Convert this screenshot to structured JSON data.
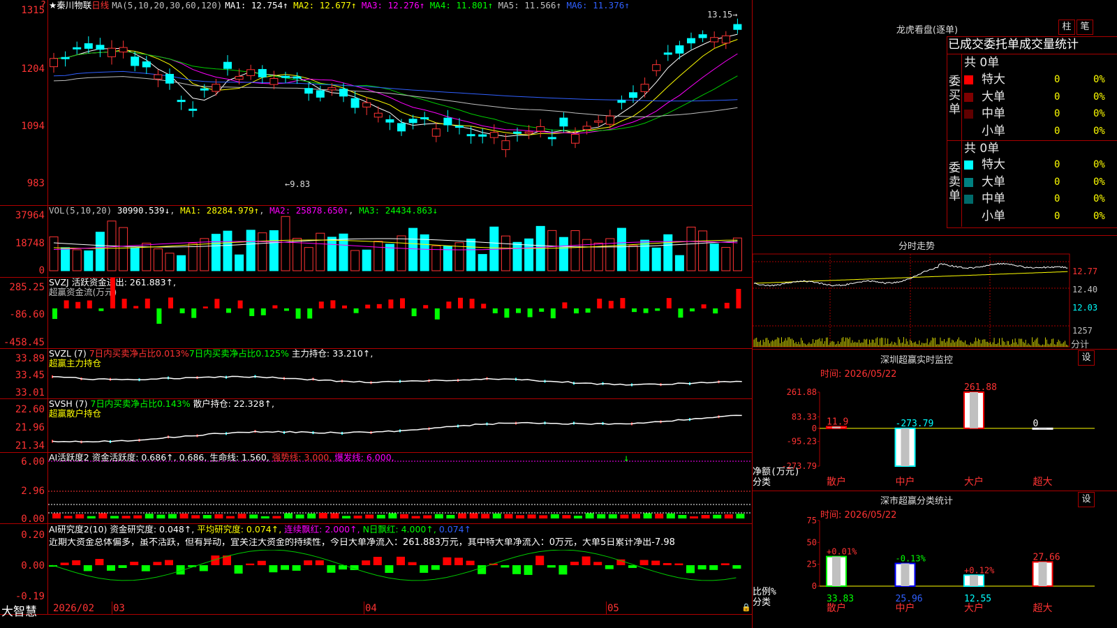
{
  "stock": {
    "name": "★秦川物联",
    "period": "日线",
    "ma_label": "MA(5,10,20,30,60,120)",
    "ma_values": [
      {
        "label": "MA1: 12.754↑",
        "color": "#ffffff"
      },
      {
        "label": "MA2: 12.677↑",
        "color": "#ffff00"
      },
      {
        "label": "MA3: 12.276↑",
        "color": "#ff00ff"
      },
      {
        "label": "MA4: 11.801↑",
        "color": "#00ff00"
      },
      {
        "label": "MA5: 11.566↑",
        "color": "#c0c0c0"
      },
      {
        "label": "MA6: 11.376↑",
        "color": "#3060ff"
      }
    ],
    "y_ticks": [
      "1315",
      "1204",
      "1094",
      "983"
    ],
    "high_mark": "13.15",
    "low_mark": "9.83"
  },
  "vol": {
    "label": "VOL(5,10,20)",
    "value": "30990.539↓",
    "ma1": "MA1: 28284.979↑",
    "ma2": "MA2: 25878.650↑",
    "ma3": "MA3: 24434.863↓",
    "y_ticks": [
      "37964",
      "18748",
      "0"
    ]
  },
  "svzj": {
    "label": "SVZJ  活跃资金进出: 261.883↑,",
    "subtitle": "超赢资金流(万元)",
    "y_ticks": [
      "285.25",
      "-86.60",
      "-458.45"
    ]
  },
  "svzl": {
    "label": "SVZL (7)",
    "t1": "7日内买卖净占比0.013%",
    "t2": "7日内买卖净占比0.125%",
    "t3": "主力持仓: 33.210↑,",
    "subtitle": "超赢主力持仓",
    "y_ticks": [
      "33.89",
      "33.45",
      "33.01"
    ]
  },
  "svsh": {
    "label": "SVSH (7)",
    "t1": "7日内买卖净占比0.143%",
    "t2": "散户持仓: 22.328↑,",
    "subtitle": "超赢散户持仓",
    "y_ticks": [
      "22.60",
      "21.96",
      "21.34"
    ]
  },
  "ai1": {
    "label": "AI活跃度2",
    "t1": "资金活跃度: 0.686↑, 0.686,",
    "t2": "生命线: 1.560,",
    "t3": "强势线: 3.000,",
    "t4": "爆发线: 6.000,",
    "y_ticks": [
      "6.00",
      "2.96",
      "0.00"
    ]
  },
  "ai2": {
    "label": "AI研究度2(10)",
    "t1": "资金研究度: 0.048↑,",
    "t2": "平均研究度: 0.074↑,",
    "t3": "连续飘红: 2.000↑,",
    "t4": "N日飘红: 4.000↑,",
    "t5": "0.074↑",
    "comment": "近期大资金总体偏多，虽不活跃，但有异动，宜关注大资金的持续性，今日大单净流入：261.883万元，其中特大单净流入：0万元，大单5日累计净出-7.98",
    "y_ticks": [
      "0.20",
      "0.00",
      "-0.19"
    ]
  },
  "footer": {
    "brand": "大智慧",
    "dates": [
      "2026/02",
      "03",
      "04",
      "05"
    ]
  },
  "longhu": {
    "title": "龙虎看盘(逐单)",
    "btn1": "柱",
    "btn2": "笔",
    "tabs": "已成交委托单成交量统计",
    "buy_label": "委买单",
    "sell_label": "委卖单",
    "buy_total": "共 0单",
    "sell_total": "共 0单",
    "buy_rows": [
      {
        "name": "特大",
        "count": "0",
        "pct": "0%",
        "color": "#ff0000"
      },
      {
        "name": "大单",
        "count": "0",
        "pct": "0%",
        "color": "#800000"
      },
      {
        "name": "中单",
        "count": "0",
        "pct": "0%",
        "color": "#600000"
      },
      {
        "name": "小单",
        "count": "0",
        "pct": "0%",
        "color": ""
      }
    ],
    "sell_rows": [
      {
        "name": "特大",
        "count": "0",
        "pct": "0%",
        "color": "#00ffff"
      },
      {
        "name": "大单",
        "count": "0",
        "pct": "0%",
        "color": "#008080"
      },
      {
        "name": "中单",
        "count": "0",
        "pct": "0%",
        "color": "#006a6a"
      },
      {
        "name": "小单",
        "count": "0",
        "pct": "0%",
        "color": ""
      }
    ]
  },
  "fenshi": {
    "title": "分时走势",
    "y_ticks": [
      "12.77",
      "12.40",
      "12.03"
    ],
    "vol_tick": "1257",
    "vol_label": "分计"
  },
  "monitor": {
    "title": "深圳超赢实时监控",
    "btn": "设",
    "time": "时间: 2026/05/22",
    "y_ticks": [
      "261.88",
      "83.33",
      "0",
      "-95.23",
      "-273.79"
    ],
    "unit": "净额(万元)",
    "cat_label": "分类",
    "chart_data": {
      "type": "bar",
      "categories": [
        "散户",
        "中户",
        "大户",
        "超大"
      ],
      "values": [
        11.9,
        -273.79,
        261.88,
        0
      ],
      "value_labels": [
        "11.9",
        "-273.79",
        "261.88",
        "0"
      ],
      "ylim": [
        -273.79,
        261.88
      ],
      "ylabel": "净额(万元)"
    }
  },
  "classify": {
    "title": "深市超赢分类统计",
    "btn": "设",
    "time": "时间: 2026/05/22",
    "y_ticks": [
      "75",
      "50",
      "25",
      "0"
    ],
    "unit": "比例%",
    "cat_label": "分类",
    "chart_data": {
      "type": "bar",
      "categories": [
        "散户",
        "中户",
        "大户",
        "超大"
      ],
      "values": [
        33.83,
        25.96,
        12.55,
        27.66
      ],
      "value_labels": [
        "33.83",
        "25.96",
        "12.55",
        "27.66"
      ],
      "changes": [
        "+0.01%",
        "-0.13%",
        "+0.12%",
        ""
      ],
      "ylim": [
        0,
        75
      ],
      "ylabel": "比例%"
    }
  }
}
